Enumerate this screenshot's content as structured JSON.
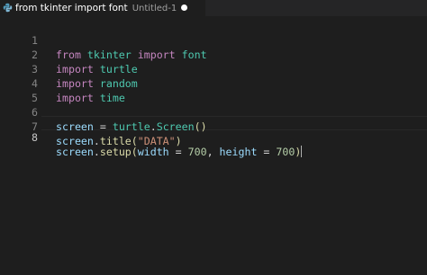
{
  "tab": {
    "title": "from tkinter import font",
    "description": "Untitled-1",
    "icon": "python-file-icon",
    "unsaved": true
  },
  "editor": {
    "active_line": 8,
    "lines": [
      {
        "number": "1",
        "tokens": [
          "from",
          "tkinter",
          "import",
          "font"
        ]
      },
      {
        "number": "2",
        "tokens": [
          "import",
          "turtle"
        ]
      },
      {
        "number": "3",
        "tokens": [
          "import",
          "random"
        ]
      },
      {
        "number": "4",
        "tokens": [
          "import",
          "time"
        ]
      },
      {
        "number": "5",
        "tokens": []
      },
      {
        "number": "6",
        "tokens": [
          "screen",
          "=",
          "turtle",
          ".",
          "Screen",
          "()"
        ]
      },
      {
        "number": "7",
        "tokens": [
          "screen",
          ".",
          "title",
          "(",
          "\"DATA\"",
          ")"
        ]
      },
      {
        "number": "8",
        "tokens": [
          "screen",
          ".",
          "setup",
          "(",
          "width",
          "=",
          "700",
          ",",
          "height",
          "=",
          "700",
          ")"
        ]
      }
    ]
  },
  "colors": {
    "background": "#1e1e1e",
    "keyword": "#c586c0",
    "module": "#4ec9b0",
    "function": "#dcdcaa",
    "string": "#ce9178",
    "number": "#b5cea8",
    "variable": "#9cdcfe",
    "text": "#d4d4d4",
    "line_number": "#858585"
  }
}
